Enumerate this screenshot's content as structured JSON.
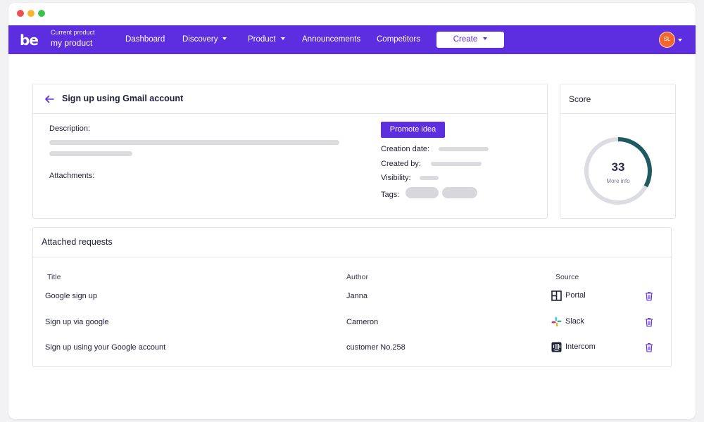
{
  "nav": {
    "logo": "be",
    "product_label": "Current product",
    "product_name": "my product",
    "items": [
      {
        "label": "Dashboard"
      },
      {
        "label": "Discovery"
      },
      {
        "label": "Product"
      },
      {
        "label": "Announcements"
      },
      {
        "label": "Competitors"
      }
    ],
    "create_label": "Create",
    "avatar_initials": "SL"
  },
  "idea": {
    "title": "Sign up using Gmail account",
    "description_label": "Description:",
    "attachments_label": "Attachments:",
    "promote_label": "Promote idea",
    "creation_date_label": "Creation date:",
    "created_by_label": "Created by:",
    "visibility_label": "Visibility:",
    "tags_label": "Tags:"
  },
  "score": {
    "title": "Score",
    "value": "33",
    "sub": "More info",
    "fraction": 0.33
  },
  "requests": {
    "title": "Attached requests",
    "columns": {
      "title": "Title",
      "author": "Author",
      "source": "Source"
    },
    "rows": [
      {
        "title": "Google sign up",
        "author": "Janna",
        "source": "Portal",
        "source_icon": "portal-icon"
      },
      {
        "title": "Sign up via google",
        "author": "Cameron",
        "source": "Slack",
        "source_icon": "slack-icon"
      },
      {
        "title": "Sign up using your Google account",
        "author": "customer No.258",
        "source": "Intercom",
        "source_icon": "intercom-icon"
      }
    ]
  },
  "colors": {
    "brand": "#5d2de0",
    "score_arc": "#1f5a61",
    "avatar": "#f2682c"
  }
}
